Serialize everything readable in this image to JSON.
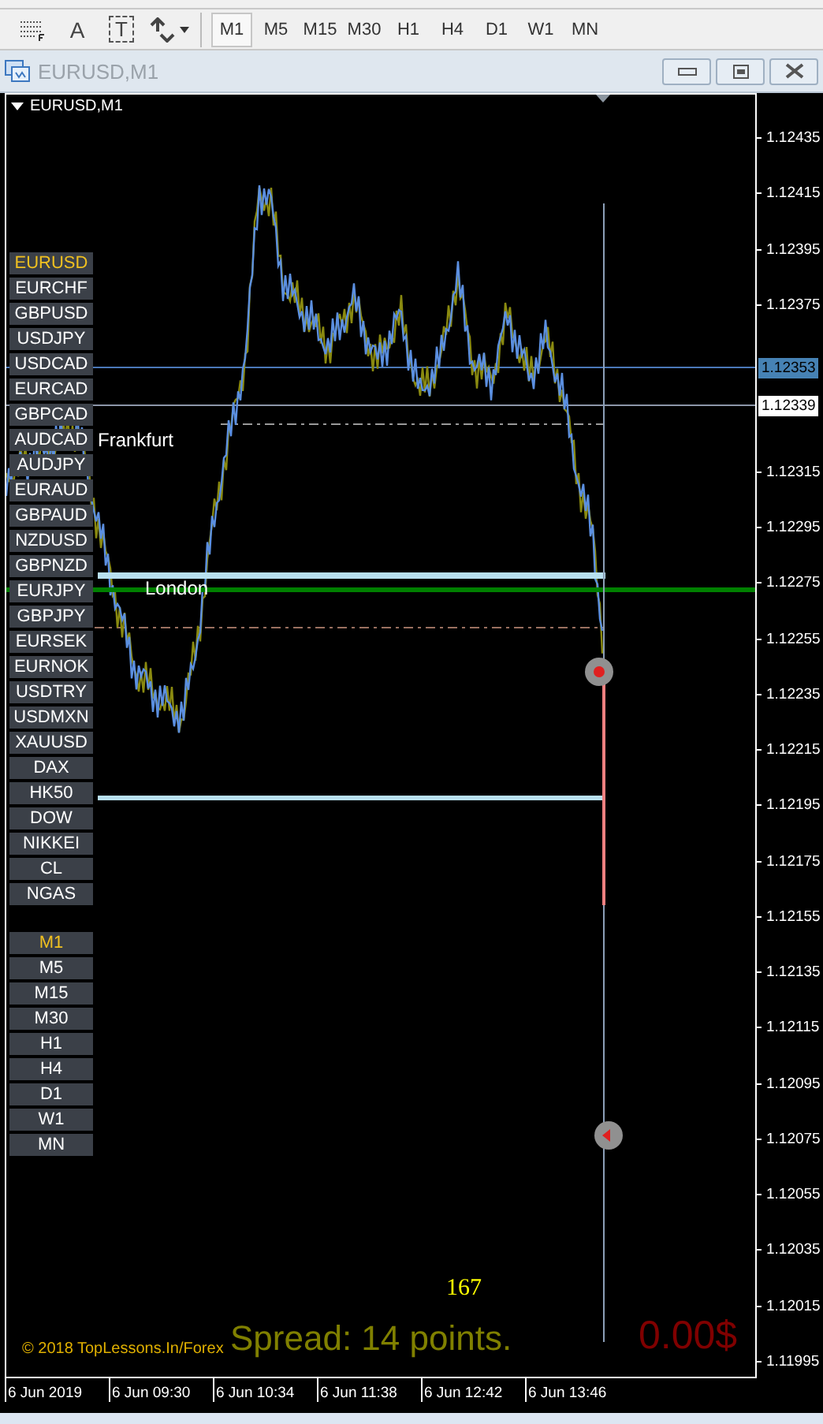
{
  "toolbar": {
    "tools": [
      {
        "kind": "fibo"
      },
      {
        "kind": "text",
        "label": "A"
      },
      {
        "kind": "label",
        "label": "T"
      },
      {
        "kind": "arrows"
      }
    ],
    "timeframes": [
      {
        "label": "M1",
        "selected": true
      },
      {
        "label": "M5",
        "selected": false
      },
      {
        "label": "M15",
        "selected": false
      },
      {
        "label": "M30",
        "selected": false
      },
      {
        "label": "H1",
        "selected": false
      },
      {
        "label": "H4",
        "selected": false
      },
      {
        "label": "D1",
        "selected": false
      },
      {
        "label": "W1",
        "selected": false
      },
      {
        "label": "MN",
        "selected": false
      }
    ]
  },
  "window": {
    "title": "EURUSD,M1"
  },
  "chart": {
    "header": "EURUSD,M1",
    "symbols": [
      {
        "label": "EURUSD",
        "selected": true
      },
      {
        "label": "EURCHF",
        "selected": false
      },
      {
        "label": "GBPUSD",
        "selected": false
      },
      {
        "label": "USDJPY",
        "selected": false
      },
      {
        "label": "USDCAD",
        "selected": false
      },
      {
        "label": "EURCAD",
        "selected": false
      },
      {
        "label": "GBPCAD",
        "selected": false
      },
      {
        "label": "AUDCAD",
        "selected": false
      },
      {
        "label": "AUDJPY",
        "selected": false
      },
      {
        "label": "EURAUD",
        "selected": false
      },
      {
        "label": "GBPAUD",
        "selected": false
      },
      {
        "label": "NZDUSD",
        "selected": false
      },
      {
        "label": "GBPNZD",
        "selected": false
      },
      {
        "label": "EURJPY",
        "selected": false
      },
      {
        "label": "GBPJPY",
        "selected": false
      },
      {
        "label": "EURSEK",
        "selected": false
      },
      {
        "label": "EURNOK",
        "selected": false
      },
      {
        "label": "USDTRY",
        "selected": false
      },
      {
        "label": "USDMXN",
        "selected": false
      },
      {
        "label": "XAUUSD",
        "selected": false
      },
      {
        "label": "DAX",
        "selected": false
      },
      {
        "label": "HK50",
        "selected": false
      },
      {
        "label": "DOW",
        "selected": false
      },
      {
        "label": "NIKKEI",
        "selected": false
      },
      {
        "label": "CL",
        "selected": false
      },
      {
        "label": "NGAS",
        "selected": false
      }
    ],
    "periods": [
      {
        "label": "M1",
        "selected": true
      },
      {
        "label": "M5",
        "selected": false
      },
      {
        "label": "M15",
        "selected": false
      },
      {
        "label": "M30",
        "selected": false
      },
      {
        "label": "H1",
        "selected": false
      },
      {
        "label": "H4",
        "selected": false
      },
      {
        "label": "D1",
        "selected": false
      },
      {
        "label": "W1",
        "selected": false
      },
      {
        "label": "MN",
        "selected": false
      }
    ],
    "session_labels": [
      "Frankfurt",
      "London"
    ],
    "counter": "167",
    "spread": "Spread: 14 points.",
    "profit": "0.00$",
    "copyright": "© 2018 TopLessons.In/Forex",
    "price_tags": [
      {
        "label": "1.12353",
        "kind": "bid"
      },
      {
        "label": "1.12339",
        "kind": "line"
      }
    ],
    "price_axis": {
      "upper": [
        "1.12435",
        "1.12415",
        "1.12395",
        "1.12375"
      ],
      "lower": [
        "1.12315",
        "1.12295",
        "1.12275",
        "1.12255",
        "1.12235",
        "1.12215",
        "1.12195",
        "1.12175",
        "1.12155",
        "1.12135",
        "1.12115",
        "1.12095",
        "1.12075",
        "1.12055",
        "1.12035",
        "1.12015",
        "1.11995"
      ]
    },
    "time_axis": [
      "6 Jun 2019",
      "6 Jun 09:30",
      "6 Jun 10:34",
      "6 Jun 11:38",
      "6 Jun 12:42",
      "6 Jun 13:46"
    ]
  }
}
